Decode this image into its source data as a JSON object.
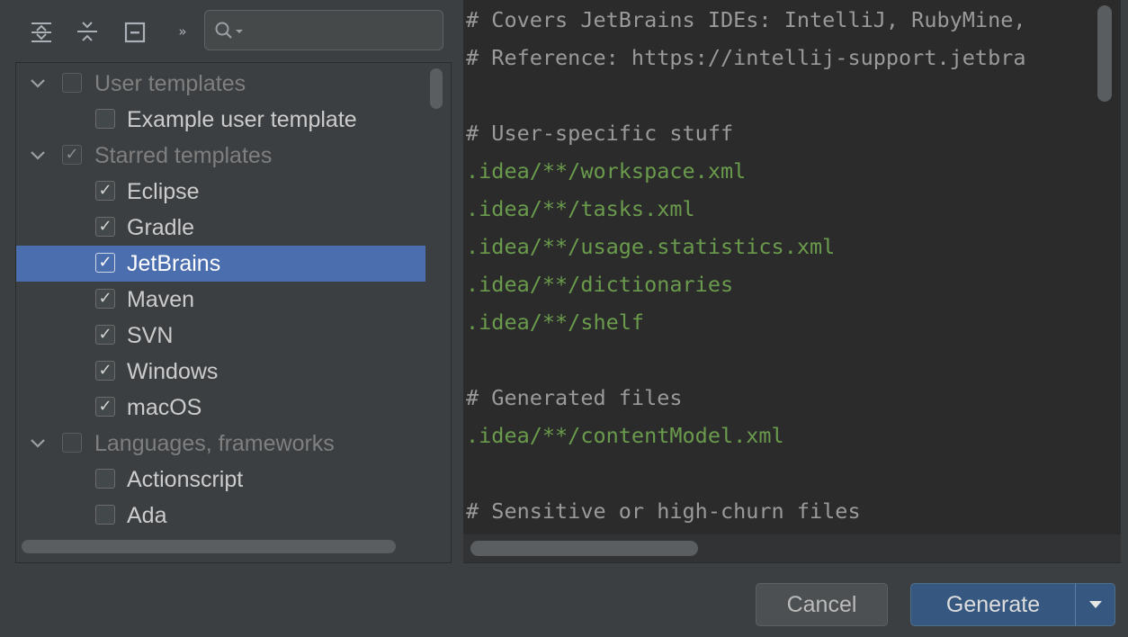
{
  "toolbar": {
    "expand_all_icon": "expand-all-icon",
    "collapse_all_icon": "collapse-all-icon",
    "collapse_icon": "collapse-icon",
    "more_icon": "double-chevron-right-icon",
    "more_label": "»",
    "search": {
      "value": "",
      "placeholder": "",
      "icon": "search-icon"
    }
  },
  "tree": {
    "rows": [
      {
        "level": 0,
        "label": "User templates",
        "checked": false,
        "expanded": true
      },
      {
        "level": 1,
        "label": "Example user template",
        "checked": false
      },
      {
        "level": 0,
        "label": "Starred templates",
        "checked": true,
        "expanded": true
      },
      {
        "level": 1,
        "label": "Eclipse",
        "checked": true
      },
      {
        "level": 1,
        "label": "Gradle",
        "checked": true
      },
      {
        "level": 1,
        "label": "JetBrains",
        "checked": true,
        "selected": true
      },
      {
        "level": 1,
        "label": "Maven",
        "checked": true
      },
      {
        "level": 1,
        "label": "SVN",
        "checked": true
      },
      {
        "level": 1,
        "label": "Windows",
        "checked": true
      },
      {
        "level": 1,
        "label": "macOS",
        "checked": true
      },
      {
        "level": 0,
        "label": "Languages, frameworks",
        "checked": false,
        "expanded": true
      },
      {
        "level": 1,
        "label": "Actionscript",
        "checked": false
      },
      {
        "level": 1,
        "label": "Ada",
        "checked": false
      }
    ],
    "check_glyph": "✓"
  },
  "editor": {
    "lines": [
      {
        "text": "# Covers JetBrains IDEs: IntelliJ, RubyMine,",
        "kind": "comment"
      },
      {
        "text": "# Reference: https://intellij-support.jetbra",
        "kind": "comment"
      },
      {
        "text": "",
        "kind": "comment"
      },
      {
        "text": "# User-specific stuff",
        "kind": "comment"
      },
      {
        "text": ".idea/**/workspace.xml",
        "kind": "path"
      },
      {
        "text": ".idea/**/tasks.xml",
        "kind": "path"
      },
      {
        "text": ".idea/**/usage.statistics.xml",
        "kind": "path"
      },
      {
        "text": ".idea/**/dictionaries",
        "kind": "path"
      },
      {
        "text": ".idea/**/shelf",
        "kind": "path"
      },
      {
        "text": "",
        "kind": "comment"
      },
      {
        "text": "# Generated files",
        "kind": "comment"
      },
      {
        "text": ".idea/**/contentModel.xml",
        "kind": "path"
      },
      {
        "text": "",
        "kind": "comment"
      },
      {
        "text": "# Sensitive or high-churn files",
        "kind": "comment"
      }
    ]
  },
  "buttons": {
    "cancel_label": "Cancel",
    "generate_label": "Generate",
    "generate_arrow_icon": "dropdown-arrow-icon"
  },
  "colors": {
    "background": "#3c3f41",
    "editor_background": "#2b2b2b",
    "selection": "#4b6eaf",
    "comment": "#9a9a9a",
    "path": "#6a9b4c",
    "primary_button": "#365880"
  }
}
